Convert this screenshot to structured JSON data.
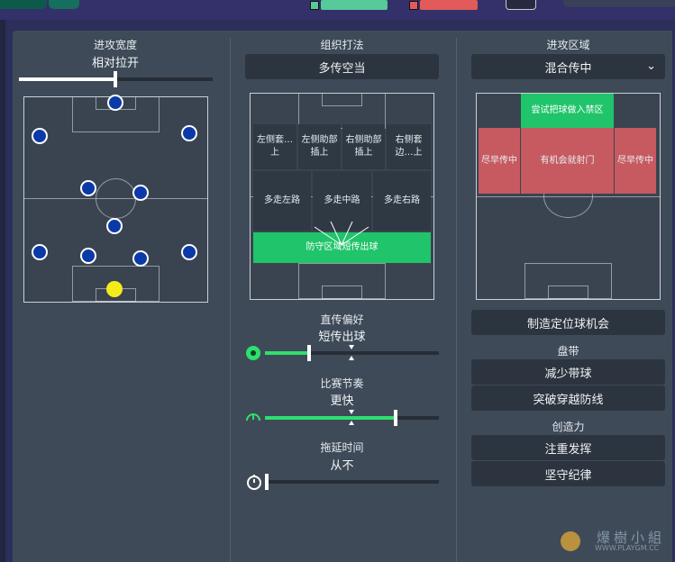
{
  "top": {
    "health_bar_color": "#58c99a",
    "risk_bar_color": "#e25a5a"
  },
  "width": {
    "title": "进攻宽度",
    "value": "相对拉开",
    "level": 0.5
  },
  "style": {
    "title": "组织打法",
    "button": "多传空当",
    "zones": {
      "left_wing": "左侧套…上",
      "left_half": "左侧助部插上",
      "right_half": "右侧助部插上",
      "right_wing": "右侧套边…上",
      "left_lane": "多走左路",
      "center_lane": "多走中路",
      "right_lane": "多走右路",
      "defense_short": "防守区域短传出球"
    }
  },
  "area": {
    "title": "进攻区域",
    "dropdown": "混合传中",
    "zones": {
      "box_work": "尝试把球做入禁区",
      "early_left": "尽早传中",
      "shoot_on_sight": "有机会就射门",
      "early_right": "尽早传中"
    },
    "set_piece_button": "制造定位球机会"
  },
  "passing": {
    "title": "直传偏好",
    "value": "短传出球",
    "level": 0.25
  },
  "tempo": {
    "title": "比赛节奏",
    "value": "更快",
    "level": 0.75
  },
  "timewasting": {
    "title": "拖延时间",
    "value": "从不",
    "level": 0.0
  },
  "dribbling": {
    "title": "盘带",
    "options": [
      "减少带球",
      "突破穿越防线"
    ]
  },
  "creative": {
    "title": "创造力",
    "options": [
      "注重发挥",
      "坚守纪律"
    ]
  },
  "watermark": {
    "brand": "爆樹小組",
    "url": "WWW.PLAYGM.CC"
  }
}
